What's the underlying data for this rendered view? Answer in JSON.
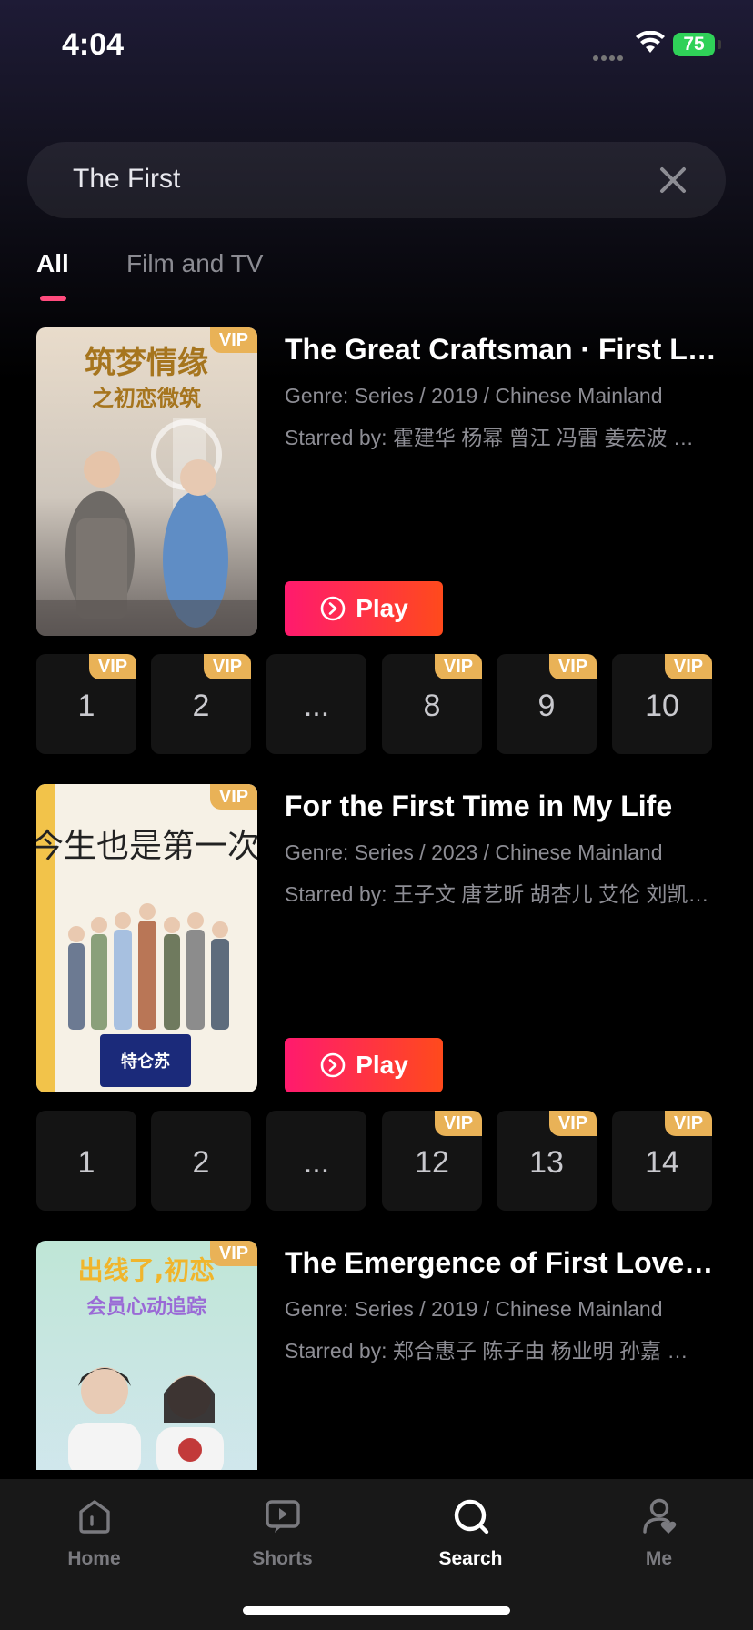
{
  "status_bar": {
    "time": "4:04",
    "battery": "75"
  },
  "search": {
    "query": "The First"
  },
  "tabs": [
    {
      "label": "All",
      "active": true
    },
    {
      "label": "Film and TV",
      "active": false
    }
  ],
  "vip_label": "VIP",
  "results": [
    {
      "title": "The Great Craftsman · First Love",
      "genre": "Genre: Series / 2019 / Chinese Mainland",
      "starring": "Starred by: 霍建华 杨幂 曾江 冯雷 姜宏波 …",
      "play_label": "Play",
      "poster_title": "筑梦情缘 之初恋微筑",
      "episodes": [
        {
          "label": "1",
          "vip": true
        },
        {
          "label": "2",
          "vip": true
        },
        {
          "label": "...",
          "vip": false
        },
        {
          "label": "8",
          "vip": true
        },
        {
          "label": "9",
          "vip": true
        },
        {
          "label": "10",
          "vip": true
        }
      ]
    },
    {
      "title": "For the First Time in My Life",
      "genre": "Genre: Series / 2023 / Chinese Mainland",
      "starring": "Starred by: 王子文 唐艺昕 胡杏儿 艾伦 刘凯 …",
      "play_label": "Play",
      "poster_title": "今生也是第一次",
      "episodes": [
        {
          "label": "1",
          "vip": false
        },
        {
          "label": "2",
          "vip": false
        },
        {
          "label": "...",
          "vip": false
        },
        {
          "label": "12",
          "vip": true
        },
        {
          "label": "13",
          "vip": true
        },
        {
          "label": "14",
          "vip": true
        }
      ]
    },
    {
      "title": "The Emergence of First Love · …",
      "genre": "Genre: Series / 2019 / Chinese Mainland",
      "starring": "Starred by: 郑合惠子 陈子由 杨业明 孙嘉 …",
      "poster_title": "出线了,初恋"
    }
  ],
  "tabbar": [
    {
      "label": "Home",
      "icon": "home-icon",
      "active": false
    },
    {
      "label": "Shorts",
      "icon": "shorts-icon",
      "active": false
    },
    {
      "label": "Search",
      "icon": "search-icon",
      "active": true
    },
    {
      "label": "Me",
      "icon": "profile-icon",
      "active": false
    }
  ],
  "colors": {
    "accent": "#ff4b7d",
    "vip_gold": "#e9b257",
    "play_start": "#ff1a6e",
    "play_end": "#ff4a1c"
  }
}
